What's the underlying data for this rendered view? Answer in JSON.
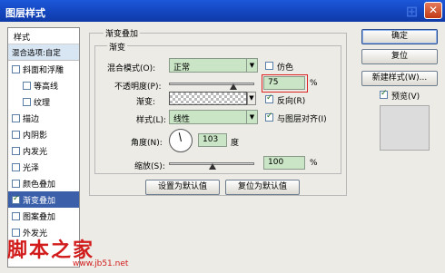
{
  "window": {
    "title": "图层样式"
  },
  "left": {
    "header": "样式",
    "blend": "混合选项:自定",
    "items": [
      {
        "label": "斜面和浮雕",
        "checked": false,
        "indent": false,
        "selected": false
      },
      {
        "label": "等高线",
        "checked": false,
        "indent": true,
        "selected": false
      },
      {
        "label": "纹理",
        "checked": false,
        "indent": true,
        "selected": false
      },
      {
        "label": "描边",
        "checked": false,
        "indent": false,
        "selected": false
      },
      {
        "label": "内阴影",
        "checked": false,
        "indent": false,
        "selected": false
      },
      {
        "label": "内发光",
        "checked": false,
        "indent": false,
        "selected": false
      },
      {
        "label": "光泽",
        "checked": false,
        "indent": false,
        "selected": false
      },
      {
        "label": "颜色叠加",
        "checked": false,
        "indent": false,
        "selected": false
      },
      {
        "label": "渐变叠加",
        "checked": true,
        "indent": false,
        "selected": true
      },
      {
        "label": "图案叠加",
        "checked": false,
        "indent": false,
        "selected": false
      },
      {
        "label": "外发光",
        "checked": false,
        "indent": false,
        "selected": false
      }
    ]
  },
  "main": {
    "outer_title": "渐变叠加",
    "inner_title": "渐变",
    "blend_mode_label": "混合模式(O):",
    "blend_mode_value": "正常",
    "dither_label": "仿色",
    "opacity_label": "不透明度(P):",
    "opacity_value": "75",
    "opacity_unit": "%",
    "gradient_label": "渐变:",
    "reverse_label": "反向(R)",
    "style_label": "样式(L):",
    "style_value": "线性",
    "align_label": "与图层对齐(I)",
    "angle_label": "角度(N):",
    "angle_value": "103",
    "angle_unit": "度",
    "scale_label": "缩放(S):",
    "scale_value": "100",
    "scale_unit": "%",
    "set_default": "设置为默认值",
    "reset_default": "复位为默认值"
  },
  "right": {
    "ok": "确定",
    "reset": "复位",
    "new_style": "新建样式(W)...",
    "preview_label": "预览(V)"
  },
  "watermark": {
    "text": "脚本之家",
    "url": "www.jb51.net"
  },
  "state": {
    "opacity_fraction": 0.75,
    "scale_fraction": 0.5,
    "dither_checked": false,
    "reverse_checked": true,
    "align_checked": true,
    "preview_checked": true
  }
}
